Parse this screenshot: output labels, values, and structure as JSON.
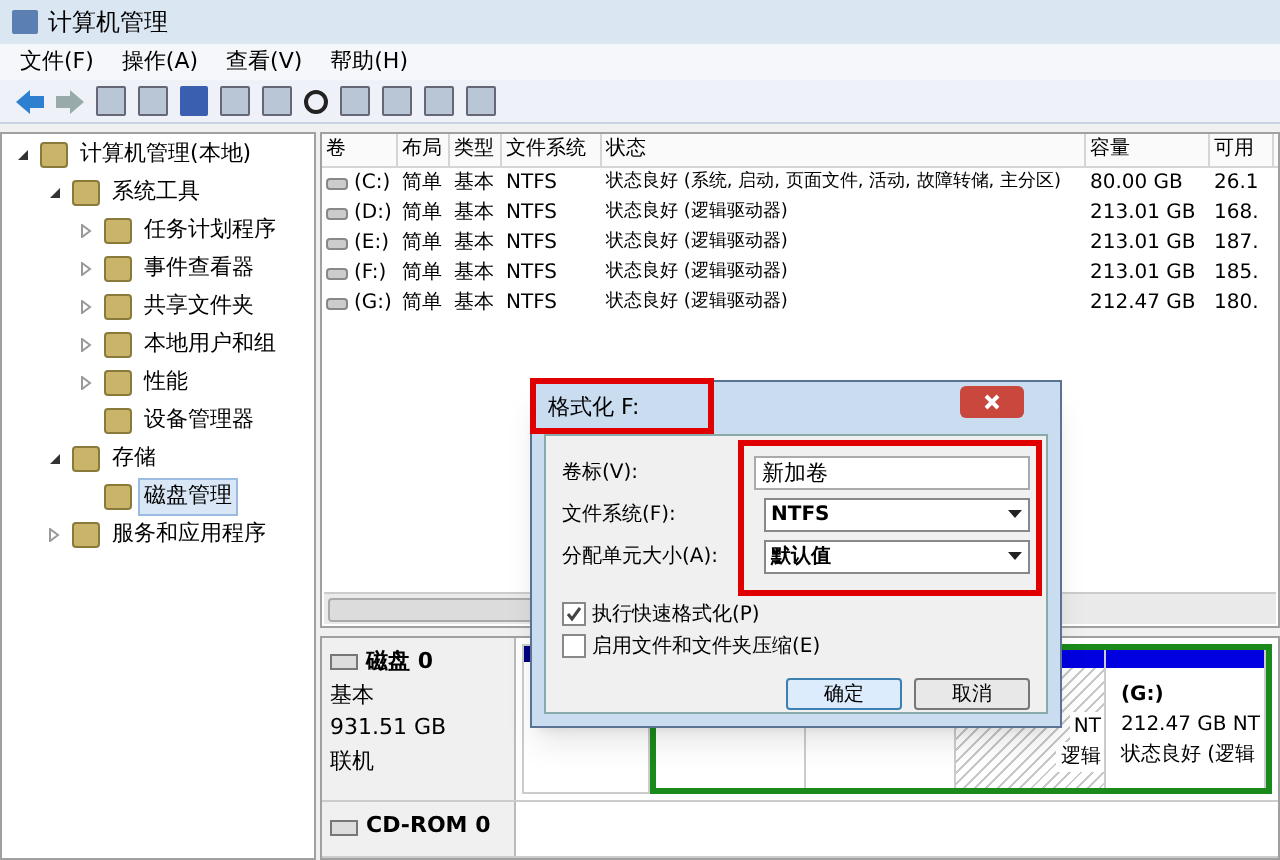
{
  "window": {
    "title": "计算机管理"
  },
  "menu": [
    "文件(F)",
    "操作(A)",
    "查看(V)",
    "帮助(H)"
  ],
  "tree": [
    {
      "label": "计算机管理(本地)",
      "expanded": true,
      "selected": false,
      "children": [
        {
          "label": "系统工具",
          "expanded": true,
          "selected": false,
          "children": [
            {
              "label": "任务计划程序",
              "expanded": false,
              "selected": false
            },
            {
              "label": "事件查看器",
              "expanded": false,
              "selected": false
            },
            {
              "label": "共享文件夹",
              "expanded": false,
              "selected": false
            },
            {
              "label": "本地用户和组",
              "expanded": false,
              "selected": false
            },
            {
              "label": "性能",
              "expanded": false,
              "selected": false
            },
            {
              "label": "设备管理器",
              "selected": false
            }
          ]
        },
        {
          "label": "存储",
          "expanded": true,
          "selected": false,
          "children": [
            {
              "label": "磁盘管理",
              "selected": true
            }
          ]
        },
        {
          "label": "服务和应用程序",
          "expanded": false,
          "selected": false
        }
      ]
    }
  ],
  "table": {
    "columns": [
      "卷",
      "布局",
      "类型",
      "文件系统",
      "状态",
      "容量",
      "可用"
    ],
    "rows": [
      [
        "(C:)",
        "简单",
        "基本",
        "NTFS",
        "状态良好 (系统, 启动, 页面文件, 活动, 故障转储, 主分区)",
        "80.00 GB",
        "26.1"
      ],
      [
        "(D:)",
        "简单",
        "基本",
        "NTFS",
        "状态良好 (逻辑驱动器)",
        "213.01 GB",
        "168."
      ],
      [
        "(E:)",
        "简单",
        "基本",
        "NTFS",
        "状态良好 (逻辑驱动器)",
        "213.01 GB",
        "187."
      ],
      [
        "(F:)",
        "简单",
        "基本",
        "NTFS",
        "状态良好 (逻辑驱动器)",
        "213.01 GB",
        "185."
      ],
      [
        "(G:)",
        "简单",
        "基本",
        "NTFS",
        "状态良好 (逻辑驱动器)",
        "212.47 GB",
        "180."
      ]
    ]
  },
  "disks": [
    {
      "kind": "disk",
      "name": "磁盘 0",
      "lines": [
        "基本",
        "931.51 GB",
        "联机"
      ],
      "partitions": [
        {
          "kind": "primary",
          "selected": false
        },
        {
          "kind": "logical",
          "selected": false
        },
        {
          "kind": "logical",
          "selected": false
        },
        {
          "kind": "logical",
          "selected": true,
          "lines": [
            "NT",
            "逻辑"
          ]
        },
        {
          "kind": "logical",
          "selected": false,
          "lines": [
            "(G:)",
            "212.47 GB NT",
            "状态良好 (逻辑"
          ]
        }
      ]
    },
    {
      "kind": "cdrom",
      "name": "CD-ROM 0"
    }
  ],
  "dialog": {
    "title": "格式化 F:",
    "fields": [
      {
        "kind": "text",
        "label": "卷标(V):",
        "value": "新加卷"
      },
      {
        "kind": "select",
        "label": "文件系统(F):",
        "value": "NTFS"
      },
      {
        "kind": "select",
        "label": "分配单元大小(A):",
        "value": "默认值"
      }
    ],
    "options": [
      {
        "label": "执行快速格式化(P)",
        "checked": true
      },
      {
        "label": "启用文件和文件夹压缩(E)",
        "checked": false
      }
    ],
    "buttons": [
      {
        "label": "确定",
        "default": true
      },
      {
        "label": "取消",
        "default": false
      }
    ]
  }
}
